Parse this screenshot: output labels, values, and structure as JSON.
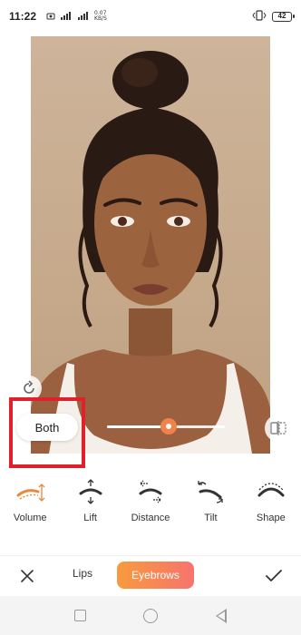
{
  "status_bar": {
    "time": "11:22",
    "network_speed_value": "0.07",
    "network_speed_unit": "KB/S",
    "battery": "42"
  },
  "editor": {
    "scope_button_label": "Both",
    "intensity_value": 0.52
  },
  "tools": [
    {
      "label": "Volume",
      "icon": "volume-icon",
      "active": true
    },
    {
      "label": "Lift",
      "icon": "lift-icon",
      "active": false
    },
    {
      "label": "Distance",
      "icon": "distance-icon",
      "active": false
    },
    {
      "label": "Tilt",
      "icon": "tilt-icon",
      "active": false
    },
    {
      "label": "Shape",
      "icon": "shape-icon",
      "active": false
    }
  ],
  "bottom_bar": {
    "tab_lips": "Lips",
    "tab_eyebrows": "Eyebrows",
    "active_tab": "Eyebrows"
  },
  "colors": {
    "accent_orange": "#e88a3a",
    "highlight_red": "#e0202a",
    "tab_gradient_start": "#f89a3e",
    "tab_gradient_end": "#f6746e"
  }
}
